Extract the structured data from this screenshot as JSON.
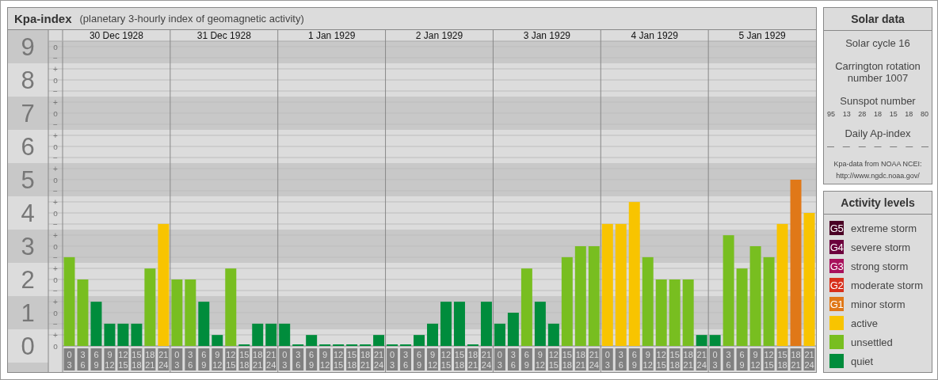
{
  "kpa_panel": {
    "title": "Kpa-index",
    "subtitle": "(planetary 3-hourly index of geomagnetic activity)",
    "day_labels": [
      "30 Dec 1928",
      "31 Dec 1928",
      "1 Jan 1929",
      "2 Jan 1929",
      "3 Jan 1929",
      "4 Jan 1929",
      "5 Jan 1929"
    ],
    "minor_yticks": [
      "o",
      "−",
      "+",
      "o",
      "−",
      "+",
      "o",
      "−",
      "+",
      "o",
      "−",
      "+",
      "o",
      "−",
      "+",
      "o",
      "−",
      "+",
      "o",
      "−",
      "+",
      "o",
      "−",
      "+",
      "o",
      "−",
      "+",
      "o"
    ],
    "chart_data": {
      "type": "bar",
      "grid": true,
      "ylim": [
        0,
        9
      ],
      "yticks": [
        {
          "value": 0,
          "label": "0"
        },
        {
          "value": 1,
          "label": "1"
        },
        {
          "value": 2,
          "label": "2"
        },
        {
          "value": 3,
          "label": "3"
        },
        {
          "value": 4,
          "label": "4"
        },
        {
          "value": 5,
          "label": "5"
        },
        {
          "value": 6,
          "label": "6"
        },
        {
          "value": 7,
          "label": "7"
        },
        {
          "value": 8,
          "label": "8"
        },
        {
          "value": 9,
          "label": "9"
        }
      ],
      "categories": [
        "0\n3",
        "3\n6",
        "6\n9",
        "9\n12",
        "12\n15",
        "15\n18",
        "18\n21",
        "21\n24",
        "0\n3",
        "3\n6",
        "6\n9",
        "9\n12",
        "12\n15",
        "15\n18",
        "18\n21",
        "21\n24",
        "0\n3",
        "3\n6",
        "6\n9",
        "9\n12",
        "12\n15",
        "15\n18",
        "18\n21",
        "21\n24",
        "0\n3",
        "3\n6",
        "6\n9",
        "9\n12",
        "12\n15",
        "15\n18",
        "18\n21",
        "21\n24",
        "0\n3",
        "3\n6",
        "6\n9",
        "9\n12",
        "12\n15",
        "15\n18",
        "18\n21",
        "21\n24",
        "0\n3",
        "3\n6",
        "6\n9",
        "9\n12",
        "12\n15",
        "15\n18",
        "18\n21",
        "21\n24",
        "0\n3",
        "3\n6",
        "6\n9",
        "9\n12",
        "12\n15",
        "15\n18",
        "18\n21",
        "21\n24"
      ],
      "series": [
        {
          "color": "#008c3c",
          "values": [
            null,
            null,
            1.33,
            0.67,
            0.67,
            0.67,
            null,
            null,
            null,
            null,
            1.33,
            0.33,
            null,
            0,
            0.67,
            0.67,
            0.67,
            0,
            0.33,
            0,
            0,
            0,
            0,
            0.33,
            0,
            0,
            0.33,
            0.67,
            1.33,
            1.33,
            0,
            1.33,
            0.67,
            1,
            null,
            1.33,
            0.67,
            null,
            null,
            null,
            null,
            null,
            null,
            null,
            null,
            null,
            null,
            0.33,
            0.33,
            null,
            null,
            null,
            null,
            null,
            null,
            null
          ]
        },
        {
          "color": "#78be20",
          "values": [
            2.67,
            2,
            null,
            null,
            null,
            null,
            2.33,
            null,
            2,
            2,
            null,
            null,
            2.33,
            null,
            null,
            null,
            null,
            null,
            null,
            null,
            null,
            null,
            null,
            null,
            null,
            null,
            null,
            null,
            null,
            null,
            null,
            null,
            null,
            null,
            2.33,
            null,
            null,
            2.67,
            3,
            3,
            null,
            null,
            null,
            2.67,
            2,
            2,
            2,
            null,
            null,
            3.33,
            2.33,
            3,
            2.67,
            null,
            null,
            null
          ]
        },
        {
          "color": "#f8c400",
          "values": [
            null,
            null,
            null,
            null,
            null,
            null,
            null,
            3.67,
            null,
            null,
            null,
            null,
            null,
            null,
            null,
            null,
            null,
            null,
            null,
            null,
            null,
            null,
            null,
            null,
            null,
            null,
            null,
            null,
            null,
            null,
            null,
            null,
            null,
            null,
            null,
            null,
            null,
            null,
            null,
            null,
            3.67,
            3.67,
            4.33,
            null,
            null,
            null,
            null,
            null,
            null,
            null,
            null,
            null,
            null,
            3.67,
            null,
            4
          ]
        },
        {
          "color": "#e07818",
          "values": [
            null,
            null,
            null,
            null,
            null,
            null,
            null,
            null,
            null,
            null,
            null,
            null,
            null,
            null,
            null,
            null,
            null,
            null,
            null,
            null,
            null,
            null,
            null,
            null,
            null,
            null,
            null,
            null,
            null,
            null,
            null,
            null,
            null,
            null,
            null,
            null,
            null,
            null,
            null,
            null,
            null,
            null,
            null,
            null,
            null,
            null,
            null,
            null,
            null,
            null,
            null,
            null,
            null,
            null,
            5,
            null
          ]
        }
      ]
    }
  },
  "solar_data": {
    "title": "Solar data",
    "solar_cycle": "Solar cycle 16",
    "carrington": "Carrington rotation number 1007",
    "sunspot_title": "Sunspot number",
    "sunspot_numbers": [
      "95",
      "13",
      "28",
      "18",
      "15",
      "18",
      "80"
    ],
    "ap_title": "Daily Ap-index",
    "ap_values": [
      "—",
      "—",
      "—",
      "—",
      "—",
      "—",
      "—"
    ],
    "source": "Kpa-data from NOAA NCEI:",
    "source_url": "http://www.ngdc.noaa.gov/"
  },
  "activity_levels": {
    "title": "Activity levels",
    "items": [
      {
        "badge": "G5",
        "label": "extreme storm",
        "color": "#4a0024"
      },
      {
        "badge": "G4",
        "label": "severe storm",
        "color": "#6c003c"
      },
      {
        "badge": "G3",
        "label": "strong storm",
        "color": "#a8105c"
      },
      {
        "badge": "G2",
        "label": "moderate storm",
        "color": "#d8301c"
      },
      {
        "badge": "G1",
        "label": "minor storm",
        "color": "#e07818"
      },
      {
        "label": "active",
        "color": "#f8c400"
      },
      {
        "label": "unsettled",
        "color": "#78be20"
      },
      {
        "label": "quiet",
        "color": "#008c3c"
      }
    ]
  }
}
